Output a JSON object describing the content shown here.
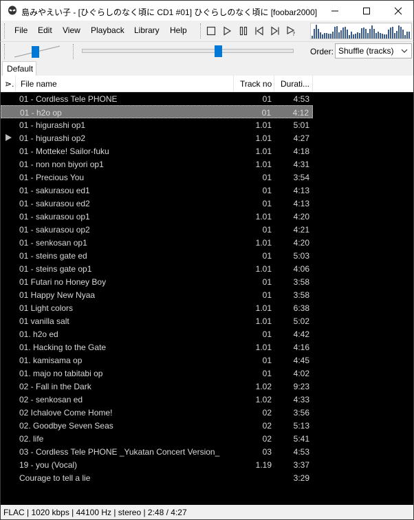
{
  "window": {
    "title": "島みやえい子 - [ひぐらしのなく頃に CD1 #01] ひぐらしのなく頃に  [foobar2000]",
    "controls": {
      "minimize_icon": "minimize-icon",
      "maximize_icon": "maximize-icon",
      "close_icon": "close-icon"
    }
  },
  "menu": [
    "File",
    "Edit",
    "View",
    "Playback",
    "Library",
    "Help"
  ],
  "transport": [
    "stop-icon",
    "play-icon",
    "pause-icon",
    "previous-icon",
    "next-icon",
    "random-icon"
  ],
  "playback_position_fraction": 0.65,
  "volume_fraction": 0.45,
  "order": {
    "label": "Order:",
    "value": "Shuffle (tracks)"
  },
  "tabs": [
    "Default"
  ],
  "columns": {
    "playing": "⋗.",
    "filename": "File name",
    "track": "Track no",
    "duration": "Durati..."
  },
  "tracks": [
    {
      "name": "01 - Cordless Tele PHONE",
      "track": "01",
      "duration": "4:53"
    },
    {
      "name": "01 - h2o op",
      "track": "01",
      "duration": "4:12",
      "focused": true
    },
    {
      "name": "01 - higurashi op1",
      "track": "1.01",
      "duration": "5:01"
    },
    {
      "name": "01 - higurashi op2",
      "track": "1.01",
      "duration": "4:27",
      "playing": true
    },
    {
      "name": "01 - Motteke! Sailor-fuku",
      "track": "1.01",
      "duration": "4:18"
    },
    {
      "name": "01 - non non biyori op1",
      "track": "1.01",
      "duration": "4:31"
    },
    {
      "name": "01 - Precious You",
      "track": "01",
      "duration": "3:54"
    },
    {
      "name": "01 - sakurasou ed1",
      "track": "01",
      "duration": "4:13"
    },
    {
      "name": "01 - sakurasou ed2",
      "track": "01",
      "duration": "4:13"
    },
    {
      "name": "01 - sakurasou op1",
      "track": "1.01",
      "duration": "4:20"
    },
    {
      "name": "01 - sakurasou op2",
      "track": "01",
      "duration": "4:21"
    },
    {
      "name": "01 - senkosan op1",
      "track": "1.01",
      "duration": "4:20"
    },
    {
      "name": "01 - steins gate ed",
      "track": "01",
      "duration": "5:03"
    },
    {
      "name": "01 - steins gate op1",
      "track": "1.01",
      "duration": "4:06"
    },
    {
      "name": "01 Futari no Honey Boy",
      "track": "01",
      "duration": "3:58"
    },
    {
      "name": "01 Happy New Nyaa",
      "track": "01",
      "duration": "3:58"
    },
    {
      "name": "01 Light colors",
      "track": "1.01",
      "duration": "6:38"
    },
    {
      "name": "01 vanilla salt",
      "track": "1.01",
      "duration": "5:02"
    },
    {
      "name": "01. h2o ed",
      "track": "01",
      "duration": "4:42"
    },
    {
      "name": "01. Hacking to the Gate",
      "track": "1.01",
      "duration": "4:16"
    },
    {
      "name": "01. kamisama op",
      "track": "01",
      "duration": "4:45"
    },
    {
      "name": "01. majo no tabitabi op",
      "track": "01",
      "duration": "4:02"
    },
    {
      "name": "02 - Fall in the Dark",
      "track": "1.02",
      "duration": "9:23"
    },
    {
      "name": "02 - senkosan ed",
      "track": "1.02",
      "duration": "4:33"
    },
    {
      "name": "02 Ichalove Come Home!",
      "track": "02",
      "duration": "3:56"
    },
    {
      "name": "02. Goodbye Seven Seas",
      "track": "02",
      "duration": "5:13"
    },
    {
      "name": "02. life",
      "track": "02",
      "duration": "5:41"
    },
    {
      "name": "03 - Cordless Tele PHONE _Yukatan Concert Version_",
      "track": "03",
      "duration": "4:53"
    },
    {
      "name": "19 - you (Vocal)",
      "track": "1.19",
      "duration": "3:37"
    },
    {
      "name": "Courage to tell a lie",
      "track": "",
      "duration": "3:29"
    }
  ],
  "status": "FLAC | 1020 kbps | 44100 Hz | stereo | 2:48 / 4:27"
}
